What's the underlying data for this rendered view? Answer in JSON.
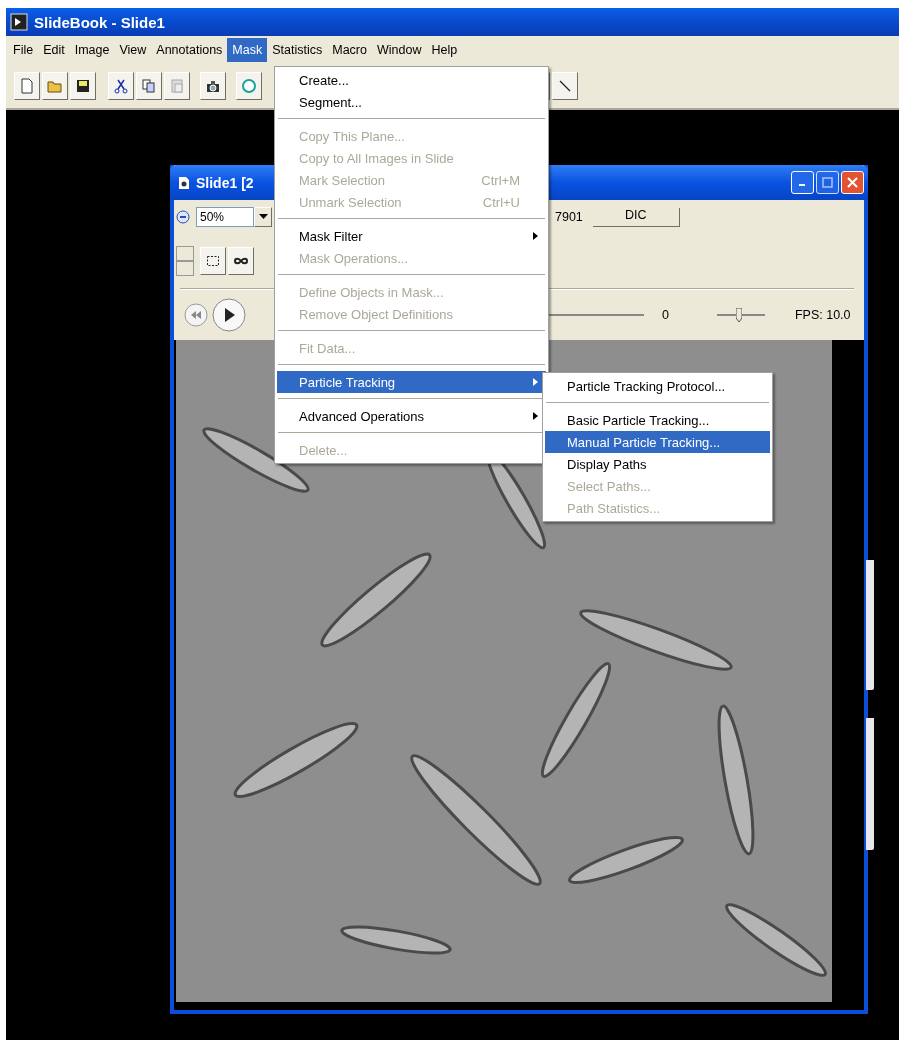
{
  "app_window": {
    "title": "SlideBook - Slide1"
  },
  "menubar": [
    {
      "label": "File",
      "selected": false
    },
    {
      "label": "Edit",
      "selected": false
    },
    {
      "label": "Image",
      "selected": false
    },
    {
      "label": "View",
      "selected": false
    },
    {
      "label": "Annotations",
      "selected": false
    },
    {
      "label": "Mask",
      "selected": true
    },
    {
      "label": "Statistics",
      "selected": false
    },
    {
      "label": "Macro",
      "selected": false
    },
    {
      "label": "Window",
      "selected": false
    },
    {
      "label": "Help",
      "selected": false
    }
  ],
  "image_window": {
    "title": "Slide1 [2",
    "zoom": "50%",
    "frame_code": "7901",
    "channel_button": "DIC",
    "frame_number": "0",
    "fps_slider": {
      "level": 0.45
    },
    "fps": "FPS: 10.0"
  },
  "menu": {
    "items": [
      {
        "kind": "item",
        "label": "Create...",
        "disabled": false,
        "selected": false,
        "submenu": false
      },
      {
        "kind": "item",
        "label": "Segment...",
        "disabled": false,
        "selected": false,
        "submenu": false
      },
      {
        "kind": "separator"
      },
      {
        "kind": "item",
        "label": "Copy This Plane...",
        "disabled": true,
        "selected": false,
        "submenu": false
      },
      {
        "kind": "item",
        "label": "Copy to All Images in Slide",
        "disabled": true,
        "selected": false,
        "submenu": false
      },
      {
        "kind": "item",
        "label": "Mark Selection",
        "shortcut": "Ctrl+M",
        "disabled": true,
        "selected": false,
        "submenu": false
      },
      {
        "kind": "item",
        "label": "Unmark Selection",
        "shortcut": "Ctrl+U",
        "disabled": true,
        "selected": false,
        "submenu": false
      },
      {
        "kind": "separator"
      },
      {
        "kind": "item",
        "label": "Mask Filter",
        "disabled": false,
        "selected": false,
        "submenu": true
      },
      {
        "kind": "item",
        "label": "Mask Operations...",
        "disabled": true,
        "selected": false,
        "submenu": false
      },
      {
        "kind": "separator"
      },
      {
        "kind": "item",
        "label": "Define Objects in Mask...",
        "disabled": true,
        "selected": false,
        "submenu": false
      },
      {
        "kind": "item",
        "label": "Remove Object Definitions",
        "disabled": true,
        "selected": false,
        "submenu": false
      },
      {
        "kind": "separator"
      },
      {
        "kind": "item",
        "label": "Fit Data...",
        "disabled": true,
        "selected": false,
        "submenu": false
      },
      {
        "kind": "separator"
      },
      {
        "kind": "item",
        "label": "Particle Tracking",
        "disabled": false,
        "selected": true,
        "submenu": true
      },
      {
        "kind": "separator"
      },
      {
        "kind": "item",
        "label": "Advanced Operations",
        "disabled": false,
        "selected": false,
        "submenu": true
      },
      {
        "kind": "separator"
      },
      {
        "kind": "item",
        "label": "Delete...",
        "disabled": true,
        "selected": false,
        "submenu": false
      }
    ]
  },
  "submenu": {
    "items": [
      {
        "kind": "item",
        "label": "Particle Tracking Protocol...",
        "disabled": false,
        "selected": false,
        "submenu": false
      },
      {
        "kind": "separator"
      },
      {
        "kind": "item",
        "label": "Basic Particle Tracking...",
        "disabled": false,
        "selected": false,
        "submenu": false
      },
      {
        "kind": "item",
        "label": "Manual Particle Tracking...",
        "disabled": false,
        "selected": true,
        "submenu": false
      },
      {
        "kind": "item",
        "label": "Display Paths",
        "disabled": false,
        "selected": false,
        "submenu": false
      },
      {
        "kind": "item",
        "label": "Select Paths...",
        "disabled": true,
        "selected": false,
        "submenu": false
      },
      {
        "kind": "item",
        "label": "Path Statistics...",
        "disabled": true,
        "selected": false,
        "submenu": false
      }
    ]
  }
}
